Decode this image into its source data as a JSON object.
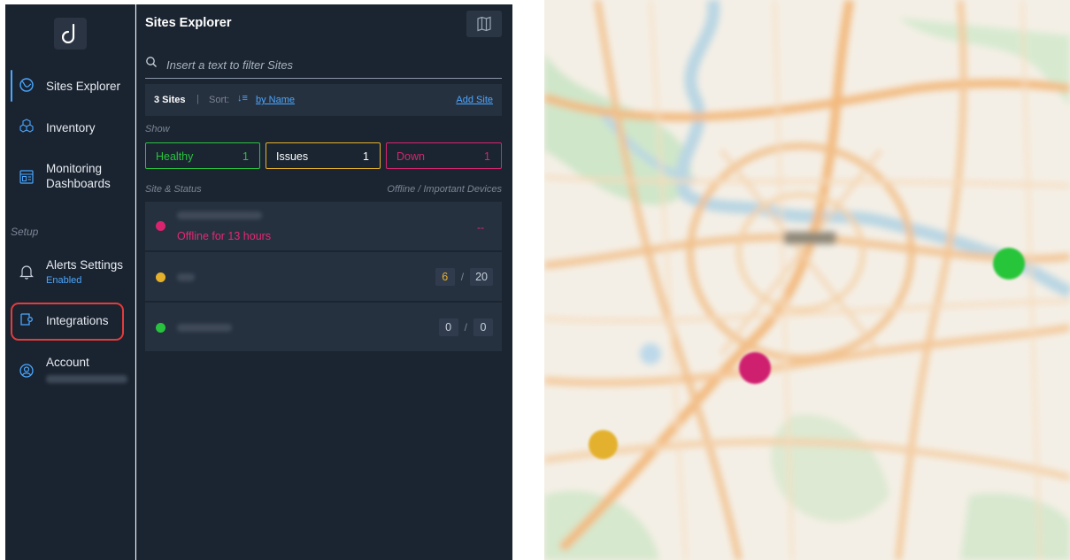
{
  "nav": {
    "items": [
      {
        "label": "Sites Explorer",
        "icon": "globe-icon",
        "active": true
      },
      {
        "label": "Inventory",
        "icon": "cubes-icon"
      },
      {
        "label": "Monitoring Dashboards",
        "line1": "Monitoring",
        "line2": "Dashboards",
        "icon": "dashboard-icon"
      }
    ],
    "setup_label": "Setup",
    "alerts": {
      "label": "Alerts Settings",
      "status": "Enabled",
      "icon": "bell-icon"
    },
    "integrations": {
      "label": "Integrations",
      "icon": "plug-icon"
    },
    "account": {
      "label": "Account",
      "icon": "user-circle-icon"
    }
  },
  "explorer": {
    "title": "Sites Explorer",
    "search_placeholder": "Insert a text to filter Sites",
    "site_count": "3 Sites",
    "separator": "|",
    "sort_label": "Sort:",
    "sort_icon": "↓≡",
    "sort_value": "by Name",
    "add_site": "Add Site",
    "show_label": "Show",
    "filters": [
      {
        "label": "Healthy",
        "count": "1",
        "color": "#29c23f"
      },
      {
        "label": "Issues",
        "count": "1",
        "color": "#e6b12a"
      },
      {
        "label": "Down",
        "count": "1",
        "color": "#d8246e"
      }
    ],
    "col_left": "Site & Status",
    "col_right": "Offline / Important Devices",
    "sites": [
      {
        "status_color": "#d8246e",
        "status_text": "Offline for 13 hours",
        "devices": "--"
      },
      {
        "status_color": "#e6b12a",
        "offline": "6",
        "slash": "/",
        "important": "20"
      },
      {
        "status_color": "#29c23f",
        "offline": "0",
        "slash": "/",
        "important": "0"
      }
    ]
  },
  "colors": {
    "healthy": "#29c23f",
    "issues": "#e6b12a",
    "down": "#d8246e",
    "accent": "#4aa7ff"
  }
}
